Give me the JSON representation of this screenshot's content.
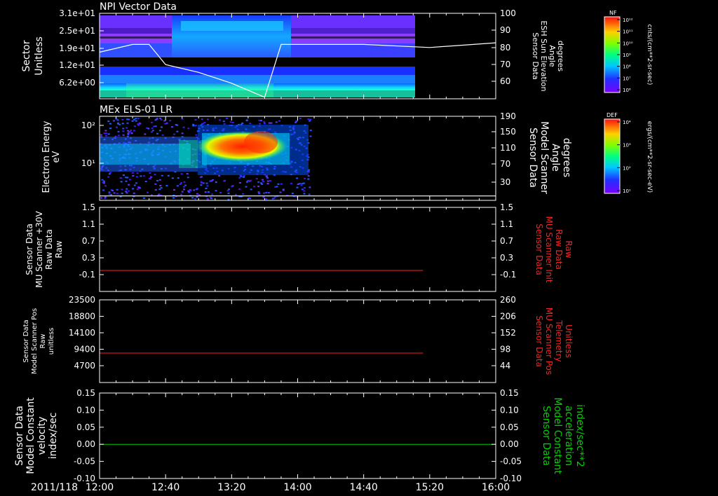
{
  "colors": {
    "background": "#000000",
    "axis": "#ffffff",
    "red": "#ff2020",
    "green": "#00d000"
  },
  "time_axis": {
    "date": "2011/118",
    "ticks": [
      "12:00",
      "12:40",
      "13:20",
      "14:00",
      "14:40",
      "15:20",
      "16:00"
    ]
  },
  "chart_data": [
    {
      "type": "heatmap",
      "title": "NPI Vector Data",
      "ylabel": [
        "Sector",
        "Unitless"
      ],
      "y_ticks": [
        "3.1e+01",
        "2.5e+01",
        "1.9e+01",
        "1.2e+01",
        "6.2e+00"
      ],
      "y2_label": [
        "Sensor Data",
        "ESH Sun Elevation",
        "Angle",
        "degrees"
      ],
      "y2_ticks": [
        "100",
        "90",
        "80",
        "70",
        "60"
      ],
      "y2lim": [
        45,
        100
      ],
      "overlay_line": {
        "x": [
          "12:00",
          "12:20",
          "12:30",
          "12:40",
          "13:00",
          "13:20",
          "13:40",
          "13:50",
          "14:00",
          "14:40",
          "15:20",
          "16:00"
        ],
        "y": [
          75,
          80,
          80,
          67,
          62,
          55,
          46,
          80,
          80,
          80,
          78,
          81
        ]
      },
      "colorbar": {
        "label": "NF",
        "units": "cnts/(cm**2-sr-sec)",
        "ticks": [
          "10¹²",
          "10¹¹",
          "10¹⁰",
          "10⁹",
          "10⁸",
          "10⁷",
          "10⁶"
        ]
      },
      "data_extent": [
        "12:00",
        "15:16"
      ]
    },
    {
      "type": "heatmap",
      "title": "MEx ELS-01 LR",
      "ylabel": [
        "Electron Energy",
        "eV"
      ],
      "y_ticks": [
        "10²",
        "10¹"
      ],
      "y2_label": [
        "Sensor Data",
        "Model Scanner",
        "Angle",
        "degrees"
      ],
      "y2_ticks": [
        "190",
        "150",
        "110",
        "70",
        "30"
      ],
      "y2lim": [
        0,
        190
      ],
      "overlay_line": {
        "x": [
          "12:00",
          "16:00"
        ],
        "y": [
          10,
          10
        ]
      },
      "colorbar": {
        "label": "DEF",
        "units": "ergs/(cm**2-sr-sec-eV)",
        "ticks": [
          "10⁴",
          "10³",
          "10²",
          "10¹"
        ]
      },
      "data_extent": [
        "12:00",
        "14:05"
      ]
    },
    {
      "type": "line",
      "ylabel": [
        "Sensor Data",
        "MU Scanner +30V",
        "Raw Data",
        "Raw"
      ],
      "y_ticks": [
        "1.5",
        "1.1",
        "0.7",
        "0.3",
        "-0.1"
      ],
      "ylim": [
        -0.3,
        1.5
      ],
      "y2_label": [
        "Sensor Data",
        "MU Scanner Init",
        "Raw Data",
        "Raw"
      ],
      "y2_ticks": [
        "1.5",
        "1.1",
        "0.7",
        "0.3",
        "-0.1"
      ],
      "series": [
        {
          "color": "#ff2020",
          "x": [
            "12:00",
            "15:16"
          ],
          "y": [
            0,
            0
          ]
        }
      ]
    },
    {
      "type": "line",
      "ylabel": [
        "Sensor Data",
        "Model Scanner Pos",
        "Raw",
        "unitless"
      ],
      "y_ticks": [
        "23500",
        "18800",
        "14100",
        "9400",
        "4700"
      ],
      "ylim": [
        0,
        23500
      ],
      "y2_label": [
        "Sensor Data",
        "MU Scanner Pos",
        "Telemetry",
        "Unitless"
      ],
      "y2_ticks": [
        "260",
        "206",
        "152",
        "98",
        "44"
      ],
      "series": [
        {
          "color": "#ff2020",
          "x": [
            "12:00",
            "15:16"
          ],
          "y": [
            8300,
            8300
          ]
        }
      ]
    },
    {
      "type": "line",
      "ylabel": [
        "Sensor Data",
        "Model Constant",
        "velocity",
        "index/sec"
      ],
      "y_ticks": [
        "0.15",
        "0.10",
        "0.05",
        "0.00",
        "-0.05",
        "-0.10"
      ],
      "ylim": [
        -0.1,
        0.15
      ],
      "y2_label": [
        "Sensor Data",
        "Model Constant",
        "acceleration",
        "index/sec**2"
      ],
      "y2_ticks": [
        "0.15",
        "0.10",
        "0.05",
        "0.00",
        "-0.05",
        "-0.10"
      ],
      "series": [
        {
          "color": "#00d000",
          "x": [
            "12:00",
            "16:00"
          ],
          "y": [
            0,
            0
          ]
        }
      ]
    }
  ]
}
